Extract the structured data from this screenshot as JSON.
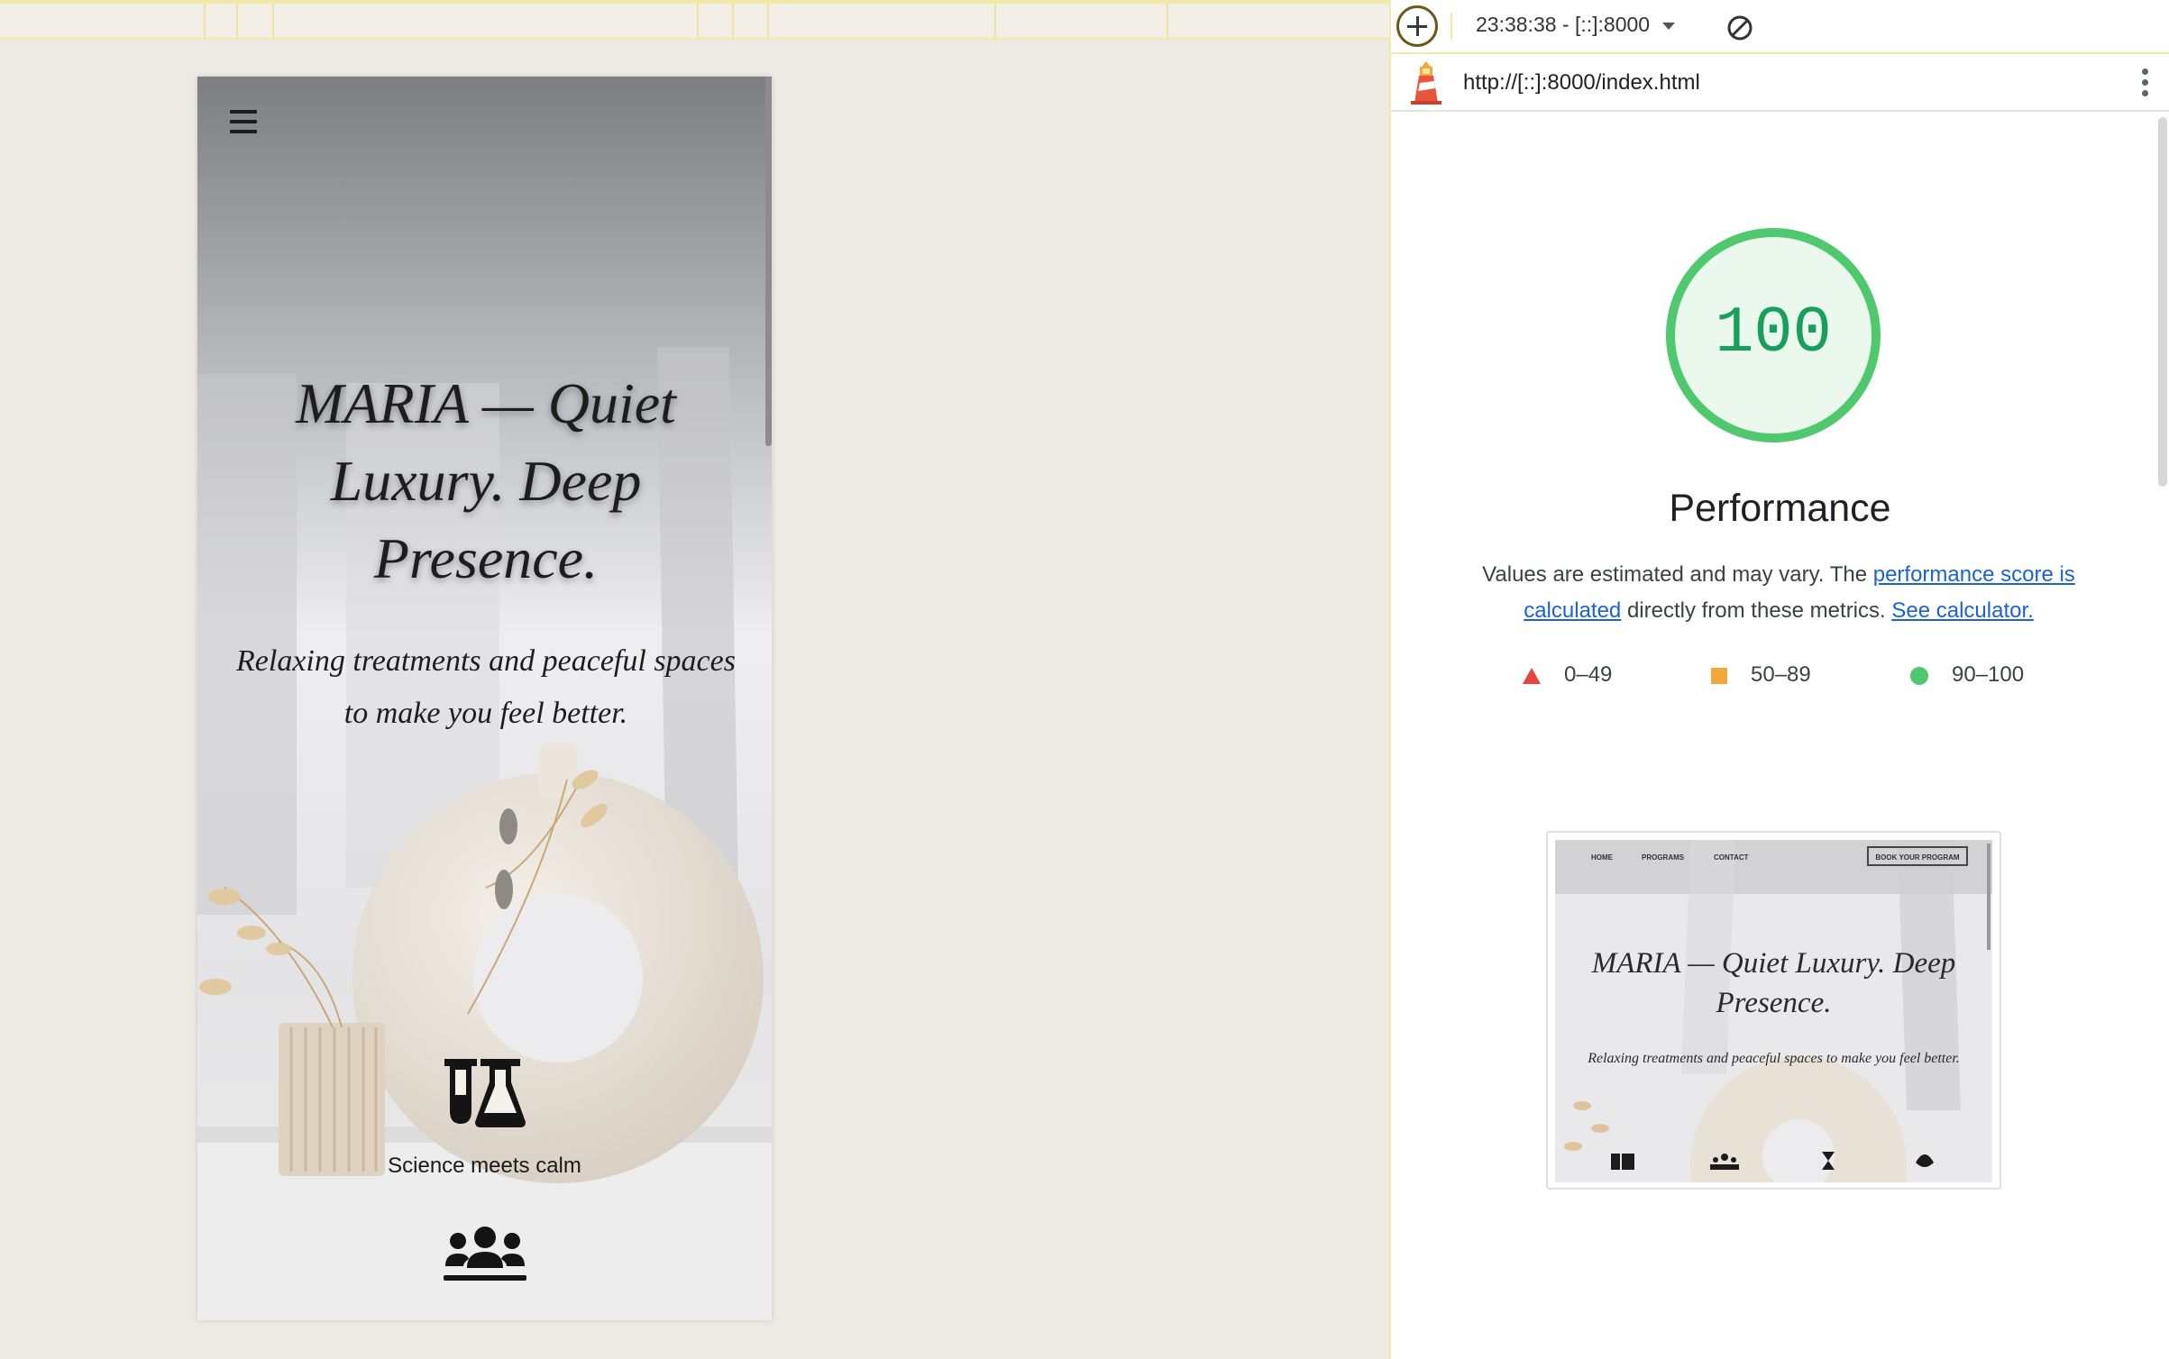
{
  "toolbar": {
    "report_time": "23:38:38 - [::]:8000",
    "new_report_label": "+"
  },
  "urlbar": {
    "url": "http://[::]:8000/index.html"
  },
  "score": {
    "value": "100",
    "value_fraction": 1.0,
    "category": "Performance",
    "color": "#0cce6b",
    "desc_part1": "Values are estimated and may vary. The ",
    "desc_link1": "performance score is calculated",
    "desc_part2": " directly from these metrics. ",
    "desc_link2": "See calculator."
  },
  "legend": [
    {
      "range": "0–49",
      "shape": "triangle",
      "color": "#e5453a"
    },
    {
      "range": "50–89",
      "shape": "square",
      "color": "#f2a73a"
    },
    {
      "range": "90–100",
      "shape": "circle",
      "color": "#4fc86e"
    }
  ],
  "site": {
    "title": "MARIA — Quiet Luxury. Deep Presence.",
    "subtitle": "Relaxing treatments and peaceful spaces to make you feel better.",
    "feature_label": "Science meets calm"
  },
  "thumbnail": {
    "nav": [
      "HOME",
      "PROGRAMS",
      "CONTACT"
    ],
    "book_button": "BOOK YOUR PROGRAM",
    "title": "MARIA — Quiet Luxury. Deep Presence.",
    "subtitle": "Relaxing treatments and peaceful spaces to make you feel better."
  }
}
